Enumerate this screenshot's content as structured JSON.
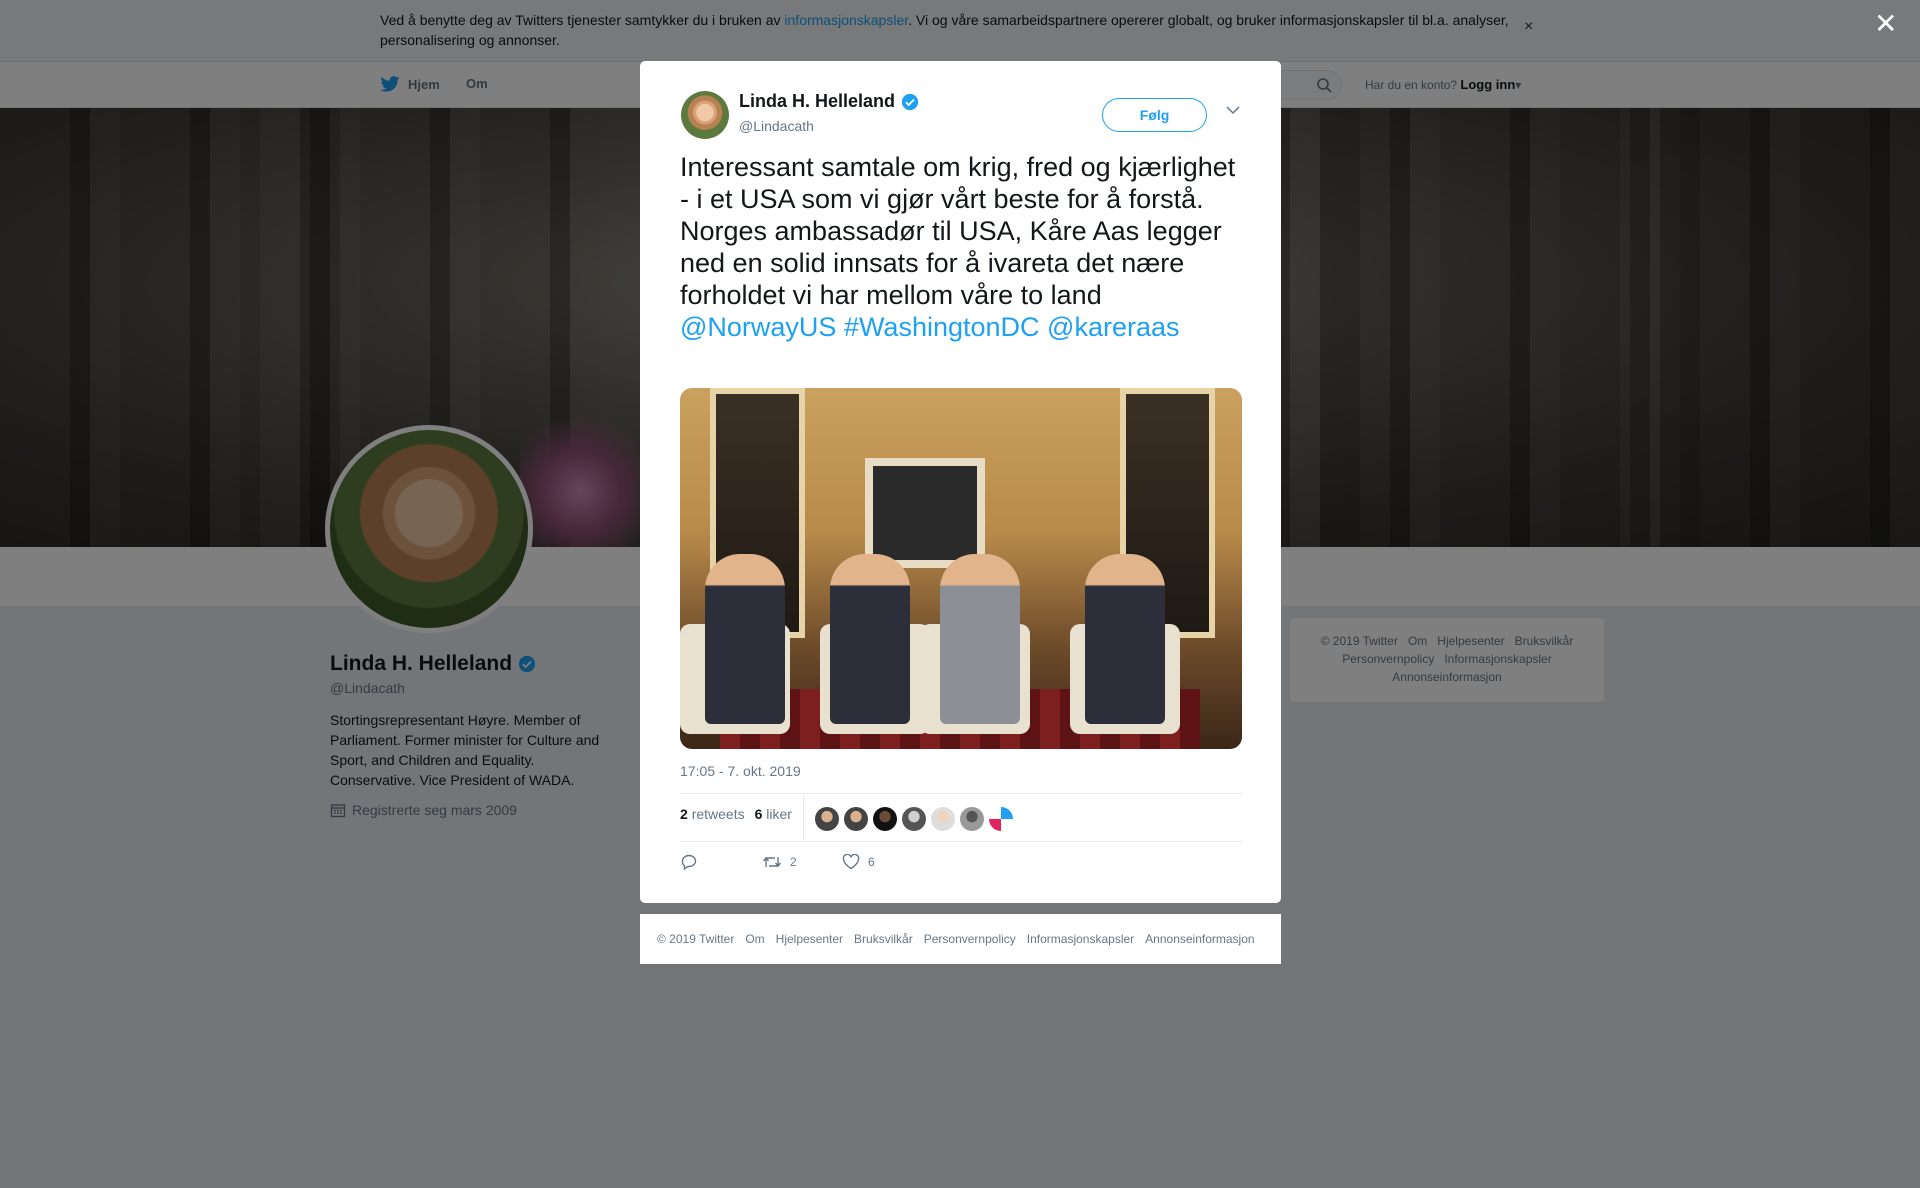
{
  "cookie": {
    "text_before": "Ved å benytte deg av Twitters tjenester samtykker du i bruken av ",
    "link": "informasjonskapsler",
    "text_after": ". Vi og våre samarbeidspartnere opererer globalt, og bruker informasjonskapsler til bl.a. analyser, personalisering og annonser.",
    "close": "×"
  },
  "nav": {
    "home": "Hjem",
    "about": "Om",
    "account_prompt": "Har du en konto?",
    "login": "Logg inn"
  },
  "profile": {
    "name": "Linda H. Helleland",
    "handle": "@Lindacath",
    "bio": "Stortingsrepresentant Høyre. Member of Parliament. Former minister for Culture and Sport, and Children and Equality. Conservative. Vice President of WADA.",
    "joined": "Registrerte seg mars 2009"
  },
  "side_footer": {
    "line1": [
      "© 2019 Twitter",
      "Om",
      "Hjelpesenter",
      "Bruksvilkår"
    ],
    "line2": [
      "Personvernpolicy",
      "Informasjonskapsler"
    ],
    "line3": [
      "Annonseinformasjon"
    ]
  },
  "overlay": {
    "close": "✕"
  },
  "tweet": {
    "name": "Linda H. Helleland",
    "handle": "@Lindacath",
    "follow": "Følg",
    "text": "Interessant samtale om krig, fred og kjærlighet -  i et USA som vi gjør vårt beste for å forstå.\nNorges ambassadør til USA, Kåre Aas legger ned en solid innsats for å ivareta det nære forholdet vi har mellom våre to land",
    "tags": "@NorwayUS #WashingtonDC @kareraas",
    "time": "17:05 - 7. okt. 2019",
    "retweets_count": "2",
    "retweets_label": "retweets",
    "likes_count": "6",
    "likes_label": "liker",
    "action_retweets": "2",
    "action_likes": "6"
  },
  "modal_footer": [
    "© 2019 Twitter",
    "Om",
    "Hjelpesenter",
    "Bruksvilkår",
    "Personvernpolicy",
    "Informasjonskapsler",
    "Annonseinformasjon"
  ],
  "colors": {
    "accent": "#1da1f2",
    "verified": "#1da1f2"
  }
}
